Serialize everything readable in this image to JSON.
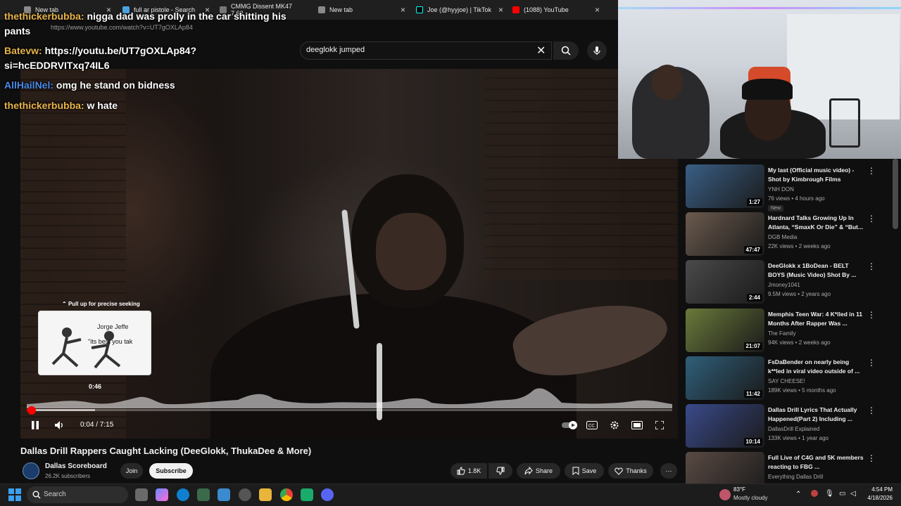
{
  "browser": {
    "tabs": [
      {
        "label": "New tab"
      },
      {
        "label": "full ar pistole - Search"
      },
      {
        "label": "CMMG Dissent MK47 7.62..."
      },
      {
        "label": "New tab"
      },
      {
        "label": "Joe (@hyyjoe) | TikTok"
      },
      {
        "label": "(1088) YouTube"
      }
    ],
    "url": "https://www.youtube.com/watch?v=UT7gOXLAp84"
  },
  "search": {
    "query": "deeglokk jumped"
  },
  "chat": [
    {
      "user": "thethickerbubba:",
      "text": "nigga dad was prolly in the car shitting his",
      "text2": "pants"
    },
    {
      "user": "Batevw:",
      "text": "https://youtu.be/UT7gOXLAp84?",
      "text2": "si=hcEDDRVITxq74IL6"
    },
    {
      "user": "AllHailNel:",
      "text": "omg he stand on bidness"
    },
    {
      "user": "thethickerbubba:",
      "text": "w hate"
    }
  ],
  "player": {
    "seek_hint": "Pull up for precise seeking",
    "preview_name": "Jorge Jeffe",
    "preview_caption": "\"its best you tak",
    "preview_time": "0:46",
    "time": "0:04 / 7:15",
    "progress_fraction": 0.009,
    "hover_fraction": 0.106
  },
  "video": {
    "title": "Dallas Drill Rappers Caught Lacking (DeeGlokk, ThukaDee & More)",
    "channel": "Dallas Scoreboard",
    "subscribers": "26.2K subscribers",
    "join_label": "Join",
    "subscribe_label": "Subscribe",
    "likes": "1.8K",
    "share_label": "Share",
    "save_label": "Save",
    "thanks_label": "Thanks"
  },
  "recommendations": [
    {
      "title": "My last (Official music video) - Shot by Kimbrough Films",
      "channel": "YNH DON",
      "meta": "76 views • 4 hours ago",
      "duration": "1:27",
      "badge": "New",
      "thumb": "#3a5f86"
    },
    {
      "title": "Hardnard Talks Growing Up In Atlanta, “SmaxK Or Die” & “But...",
      "channel": "DGB Media",
      "meta": "22K views • 2 weeks ago",
      "duration": "47:47",
      "thumb": "#6b5a4e"
    },
    {
      "title": "DeeGlokk x 1BoDean - BELT BOYS (Music Video) Shot By ...",
      "channel": "Jmoney1041",
      "meta": "9.5M views • 2 years ago",
      "duration": "2:44",
      "thumb": "#4a4a4a"
    },
    {
      "title": "Memphis Teen War: 4 K*lled in 11 Months After Rapper Was ...",
      "channel": "The Family",
      "meta": "94K views • 2 weeks ago",
      "duration": "21:07",
      "thumb": "#6a7a3a"
    },
    {
      "title": "FsDaBender on nearly being k**led in viral video outside of ...",
      "channel": "SAY CHEESE!",
      "meta": "189K views • 5 months ago",
      "duration": "11:42",
      "thumb": "#2f5f7a"
    },
    {
      "title": "Dallas Drill Lyrics That Actually Happened(Part 2) Including ...",
      "channel": "DallasDrill Explained",
      "meta": "133K views • 1 year ago",
      "duration": "10:14",
      "thumb": "#3a4a8a"
    },
    {
      "title": "Full Live of C4G and 5K members reacting to FBG ...",
      "channel": "Everything Dallas Drill",
      "meta": "",
      "duration": "",
      "thumb": "#5a4a44"
    }
  ],
  "taskbar": {
    "search_label": "Search",
    "weather_temp": "83°F",
    "weather_desc": "Mostly cloudy",
    "time": "4:54 PM",
    "date": "4/18/2026"
  },
  "colors": {
    "accent": "#ff0000",
    "bg": "#0f0f0f"
  }
}
